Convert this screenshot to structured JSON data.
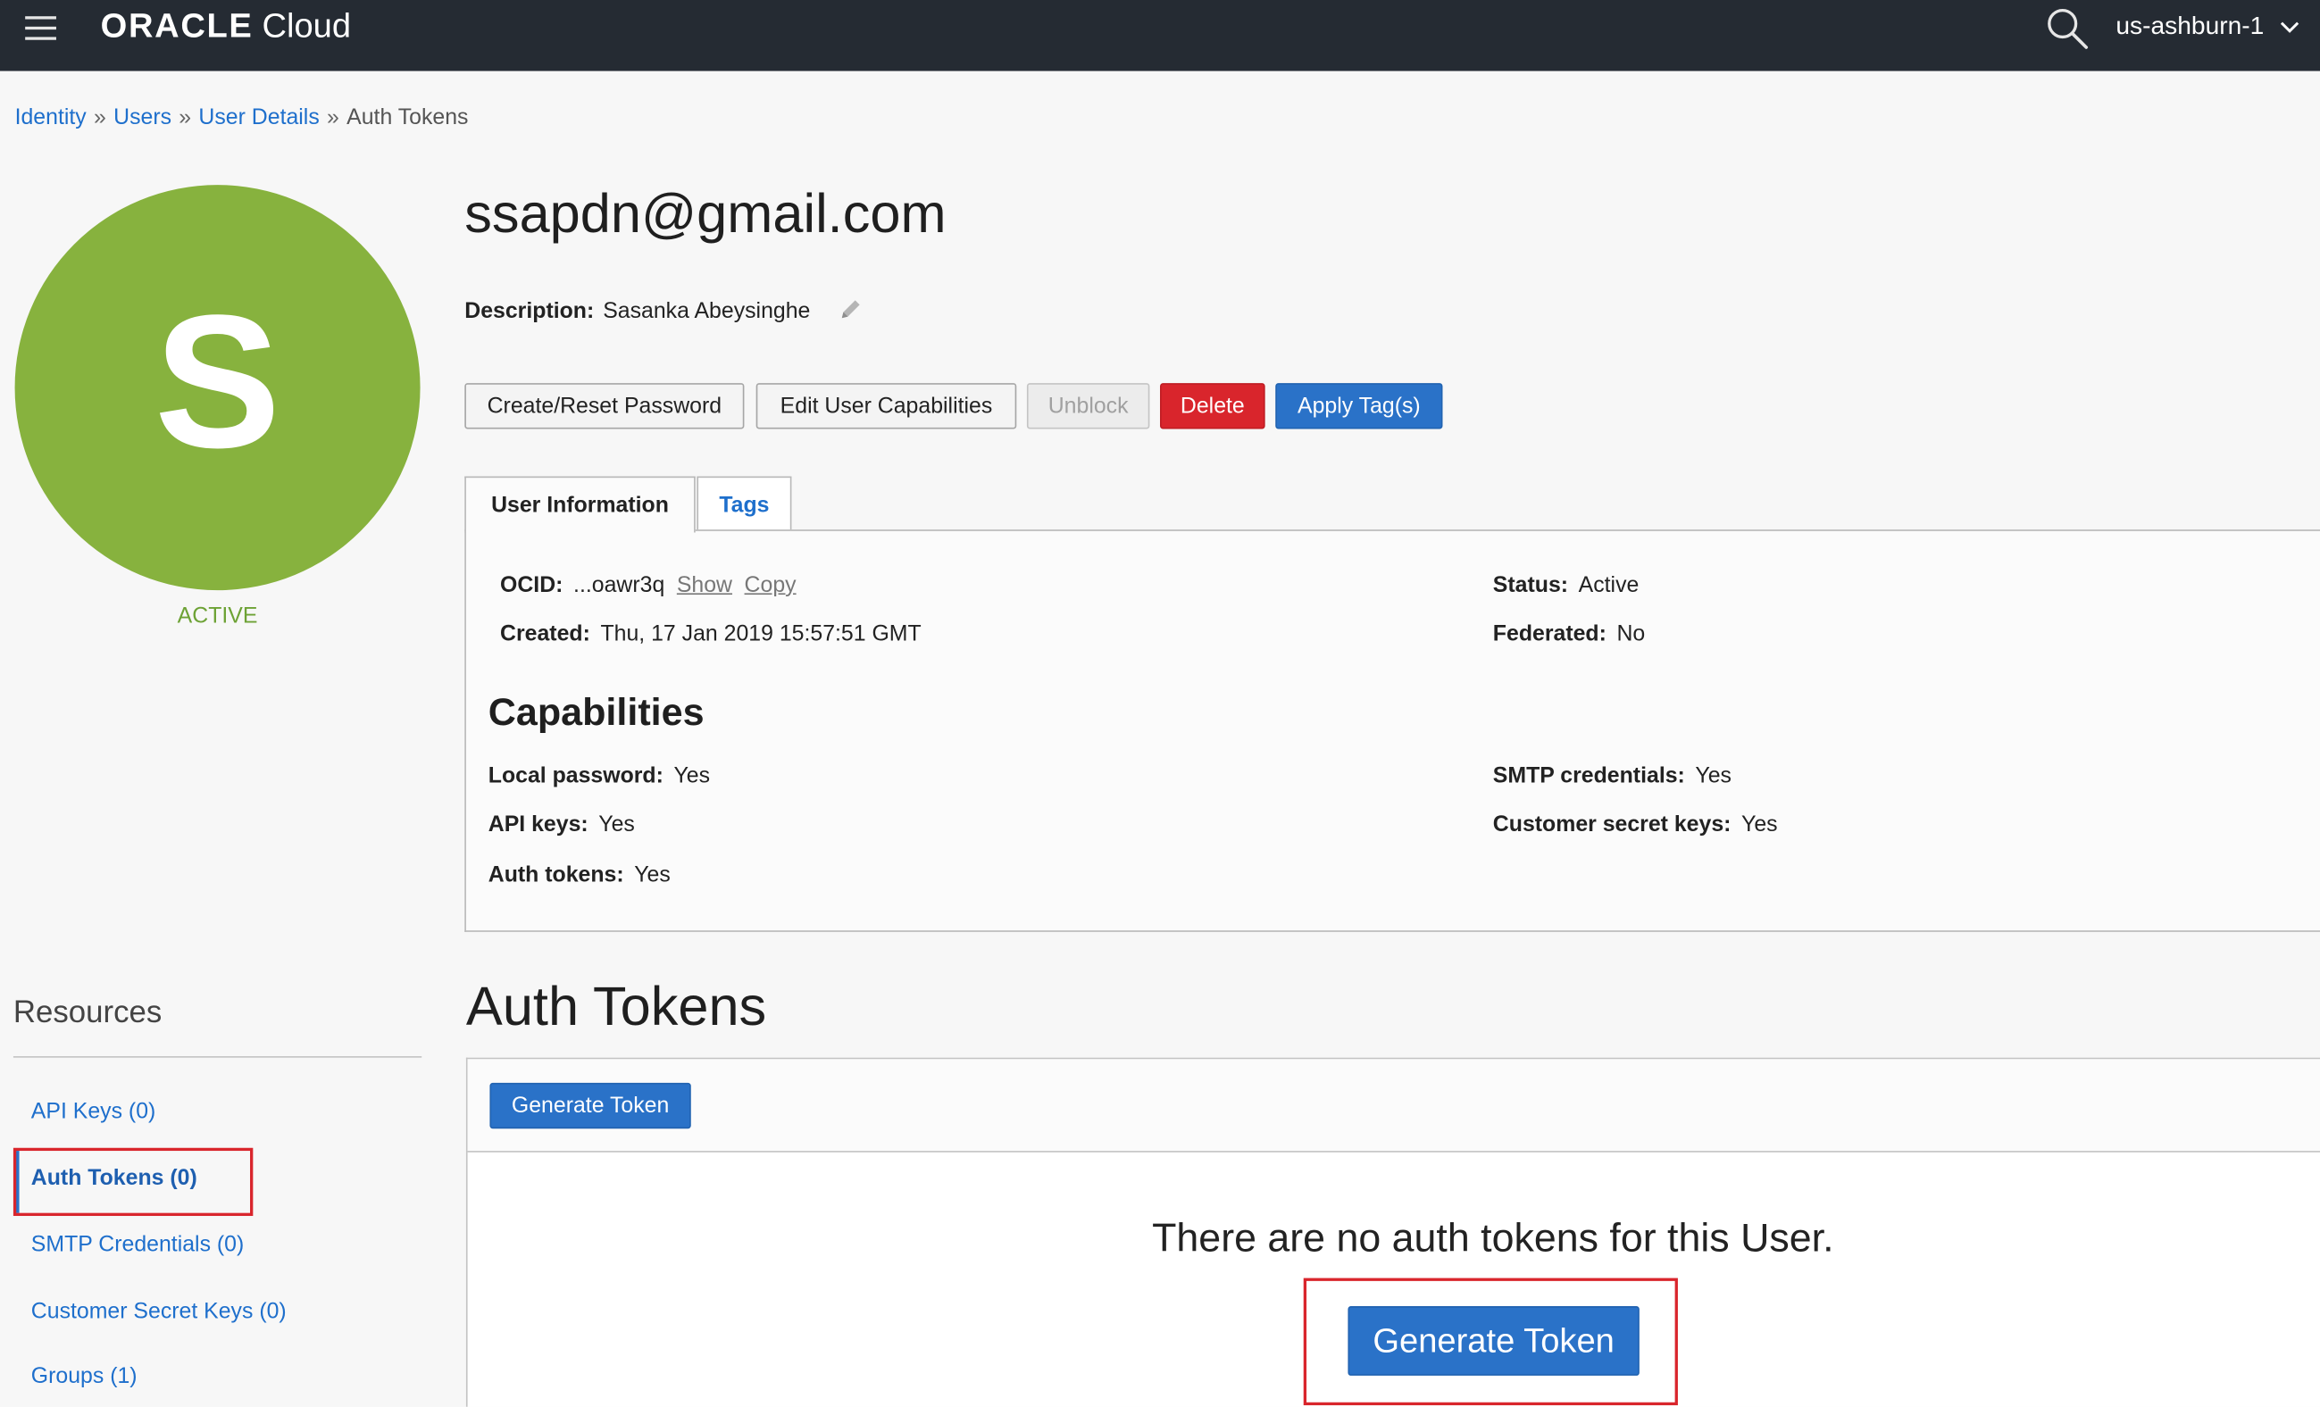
{
  "topbar": {
    "brand": "ORACLE",
    "product": "Cloud",
    "region": "us-ashburn-1"
  },
  "breadcrumb": {
    "identity": "Identity",
    "users": "Users",
    "user_details": "User Details",
    "current": "Auth Tokens",
    "separator": "»"
  },
  "avatar": {
    "letter": "S",
    "status": "ACTIVE",
    "color": "#87b23e"
  },
  "user": {
    "email": "ssapdn@gmail.com",
    "description_label": "Description:",
    "description_value": "Sasanka Abeysinghe"
  },
  "actions": {
    "create_reset_password": "Create/Reset Password",
    "edit_user_capabilities": "Edit User Capabilities",
    "unblock": "Unblock",
    "delete": "Delete",
    "apply_tags": "Apply Tag(s)"
  },
  "tabs": {
    "user_information": "User Information",
    "tags": "Tags"
  },
  "user_info": {
    "ocid_label": "OCID:",
    "ocid_value": "...oawr3q",
    "show_link": "Show",
    "copy_link": "Copy",
    "created_label": "Created:",
    "created_value": "Thu, 17 Jan 2019 15:57:51 GMT",
    "status_label": "Status:",
    "status_value": "Active",
    "federated_label": "Federated:",
    "federated_value": "No"
  },
  "capabilities": {
    "title": "Capabilities",
    "local_password_label": "Local password:",
    "local_password_value": "Yes",
    "api_keys_label": "API keys:",
    "api_keys_value": "Yes",
    "auth_tokens_label": "Auth tokens:",
    "auth_tokens_value": "Yes",
    "smtp_label": "SMTP credentials:",
    "smtp_value": "Yes",
    "customer_secret_label": "Customer secret keys:",
    "customer_secret_value": "Yes"
  },
  "resources": {
    "title": "Resources",
    "items": [
      "API Keys (0)",
      "Auth Tokens (0)",
      "SMTP Credentials (0)",
      "Customer Secret Keys (0)",
      "Groups (1)"
    ]
  },
  "auth_tokens": {
    "title": "Auth Tokens",
    "generate_button": "Generate Token",
    "empty_message": "There are no auth tokens for this User.",
    "empty_generate_button": "Generate Token"
  },
  "colors": {
    "topbar": "#252b33",
    "link": "#1e6fcc",
    "primary": "#2a72c8",
    "danger": "#d9252c",
    "highlight_box": "#d9252c"
  },
  "icons": [
    "hamburger-icon",
    "search-icon",
    "chevron-down-icon",
    "pencil-icon"
  ]
}
